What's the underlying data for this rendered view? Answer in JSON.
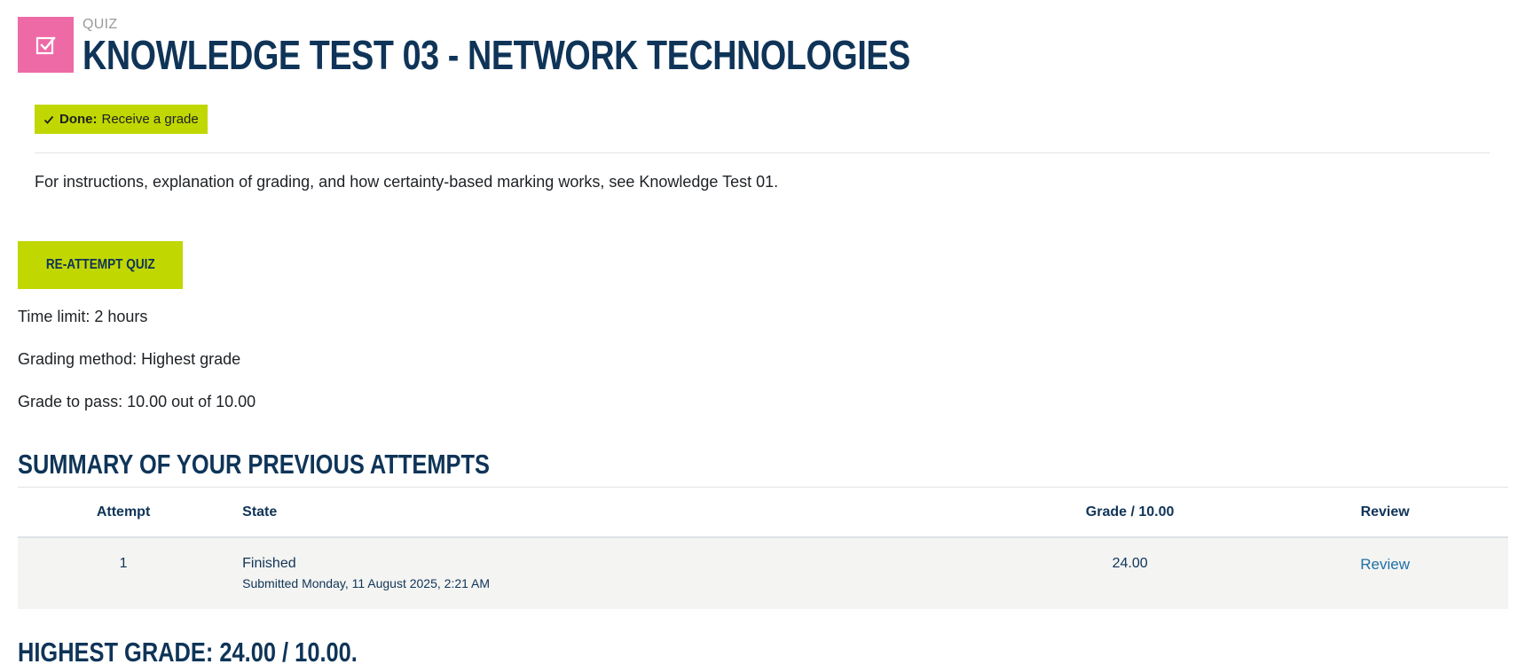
{
  "header": {
    "module_type": "QUIZ",
    "title": "KNOWLEDGE TEST 03 - NETWORK TECHNOLOGIES",
    "icon": "checkbox-icon",
    "icon_color": "#ee6aa6"
  },
  "completion": {
    "done_label": "Done:",
    "requirement": "Receive a grade",
    "badge_color": "#c1d701"
  },
  "intro": "For instructions, explanation of grading, and how certainty-based marking works, see Knowledge Test 01.",
  "actions": {
    "reattempt_label": "RE-ATTEMPT QUIZ"
  },
  "quiz_info": {
    "time_limit": "Time limit: 2 hours",
    "grading_method": "Grading method: Highest grade",
    "grade_to_pass": "Grade to pass: 10.00 out of 10.00"
  },
  "summary": {
    "heading": "SUMMARY OF YOUR PREVIOUS ATTEMPTS",
    "columns": [
      "Attempt",
      "State",
      "Grade / 10.00",
      "Review"
    ],
    "rows": [
      {
        "attempt": "1",
        "state": "Finished",
        "submitted": "Submitted Monday, 11 August 2025, 2:21 AM",
        "grade": "24.00",
        "review": "Review"
      }
    ]
  },
  "highest_grade": "HIGHEST GRADE: 24.00 / 10.00.",
  "colors": {
    "heading": "#0f3458",
    "accent": "#c1d701",
    "link": "#1f6fa8"
  }
}
